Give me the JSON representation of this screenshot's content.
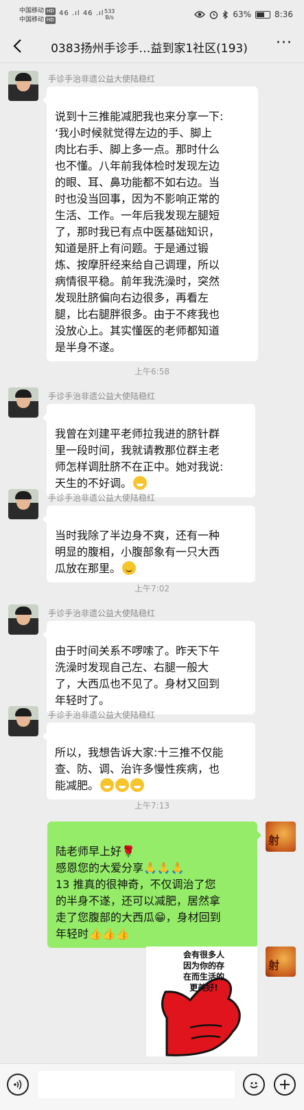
{
  "status_bar": {
    "carrier1": "中国移动",
    "carrier2": "中国移动",
    "hd": "HD",
    "network": "46 .ıl 46 .ıl",
    "speed_value": "533",
    "speed_unit": "B/s",
    "battery_percent": "63%",
    "battery_level": 0.63,
    "time": "8:36"
  },
  "header": {
    "title": "0383扬州手诊手…益到家1社区(193)",
    "more_label": "···"
  },
  "messages": [
    {
      "sender": "手诊手治非遗公益大使陆稳红",
      "text": "说到十三推能减肥我也来分享一下:\n‘我小时候就觉得左边的手、脚上\n肉比右手、脚上多一点。那时什么\n也不懂。八年前我体检时发现左边\n的眼、耳、鼻功能都不如右边。当\n时也没当回事，因为不影响正常的\n生活、工作。一年后我发现左腿短\n了，那时我已有点中医基础知识，\n知道是肝上有问题。于是通过锻\n炼、按摩肝经来给自己调理，所以\n病情很平稳。前年我洗澡时，突然\n发现肚脐偏向右边很多，再看左\n腿，比右腿胖很多。由于不疼我也\n没放心上。其实懂医的老师都知道\n是半身不遂。"
    },
    {
      "sender": "手诊手治非遗公益大使陆稳红",
      "text": "我曾在刘建平老师拉我进的脐针群\n里一段时间，我就请教那位群主老\n师怎样调肚脐不在正中。她对我说:\n天生的不好调。"
    },
    {
      "sender": "手诊手治非遗公益大使陆稳红",
      "text": "当时我除了半边身不爽，还有一种\n明显的腹相，小腹部象有一只大西\n瓜放在那里。"
    },
    {
      "sender": "手诊手治非遗公益大使陆稳红",
      "text": "由于时间关系不啰嗦了。昨天下午\n洗澡时发现自己左、右腿一般大\n了，大西瓜也不见了。身材又回到\n年轻时了。"
    },
    {
      "sender": "手诊手治非遗公益大使陆稳红",
      "text": "所以，我想告诉大家:十三推不仅能\n查、防、调、治许多慢性疾病，也\n能减肥。"
    },
    {
      "text": "陆老师早上好🌹\n感恩您的大爱分享🙏🙏🙏\n13 推真的很神奇，不仅调治了您\n的半身不遂，还可以减肥，居然拿\n走了您腹部的大西瓜😁，身材回到\n年轻时👍👍👍"
    }
  ],
  "timestamps": [
    "上午6:58",
    "上午7:02",
    "上午7:13"
  ],
  "sticker": {
    "text": "会有很多人\n因为你的存\n在而生活的\n更美好!"
  },
  "self_avatar_glyph": "射",
  "colors": {
    "background": "#ededed",
    "bubble_in": "#ffffff",
    "bubble_out": "#95ec69",
    "thumb": "#e0141c"
  }
}
